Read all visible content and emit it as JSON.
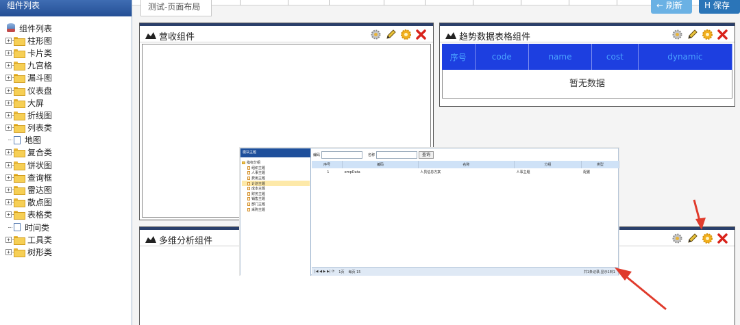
{
  "sidebar": {
    "header": "组件列表",
    "root_label": "组件列表",
    "items": [
      {
        "label": "柱形图",
        "type": "folder"
      },
      {
        "label": "卡片类",
        "type": "folder"
      },
      {
        "label": "九宫格",
        "type": "folder"
      },
      {
        "label": "漏斗图",
        "type": "folder"
      },
      {
        "label": "仪表盘",
        "type": "folder"
      },
      {
        "label": "大屏",
        "type": "folder"
      },
      {
        "label": "折线图",
        "type": "folder"
      },
      {
        "label": "列表类",
        "type": "folder"
      },
      {
        "label": "地图",
        "type": "file"
      },
      {
        "label": "复合类",
        "type": "folder"
      },
      {
        "label": "饼状图",
        "type": "folder"
      },
      {
        "label": "查询框",
        "type": "folder"
      },
      {
        "label": "雷达图",
        "type": "folder"
      },
      {
        "label": "散点图",
        "type": "folder"
      },
      {
        "label": "表格类",
        "type": "folder"
      },
      {
        "label": "时间类",
        "type": "file"
      },
      {
        "label": "工具类",
        "type": "folder"
      },
      {
        "label": "树形类",
        "type": "folder"
      }
    ]
  },
  "tab": {
    "label": "测试-页面布局"
  },
  "toolbar": {
    "refresh_label": "← 刷新",
    "save_label": "H 保存"
  },
  "widgets": {
    "revenue": {
      "title": "营收组件"
    },
    "trend": {
      "title": "趋势数据表格组件",
      "columns": [
        "序号",
        "code",
        "name",
        "cost",
        "dynamic"
      ],
      "empty_text": "暂无数据"
    },
    "multidim": {
      "title": "多维分析组件"
    }
  },
  "popup": {
    "tree_header": "模块主题",
    "tree": [
      {
        "label": "指标分组",
        "type": "root"
      },
      {
        "label": "组织主题",
        "type": "doc"
      },
      {
        "label": "人事主题",
        "type": "doc"
      },
      {
        "label": "费用主题",
        "type": "doc"
      },
      {
        "label": "计划主题",
        "type": "doc",
        "selected": true
      },
      {
        "label": "成本主题",
        "type": "doc"
      },
      {
        "label": "财务主题",
        "type": "doc"
      },
      {
        "label": "销售主题",
        "type": "doc"
      },
      {
        "label": "部门主题",
        "type": "doc"
      },
      {
        "label": "采购主题",
        "type": "doc"
      }
    ],
    "search_code_label": "编码",
    "search_name_label": "名称",
    "query_button": "查询",
    "columns": [
      "序号",
      "编码",
      "名称",
      "分组",
      "类型"
    ],
    "rows": [
      [
        "1",
        "empData",
        "人员信息方案",
        "人事主题",
        "配置"
      ]
    ],
    "pager": {
      "page_text": "1页",
      "size_text": "每页 15",
      "info": "共1条记录,显示1到1"
    }
  },
  "colors": {
    "header_blue": "#244f95",
    "table_head": "#1d3fe0",
    "accent_red": "#e03b2c"
  }
}
